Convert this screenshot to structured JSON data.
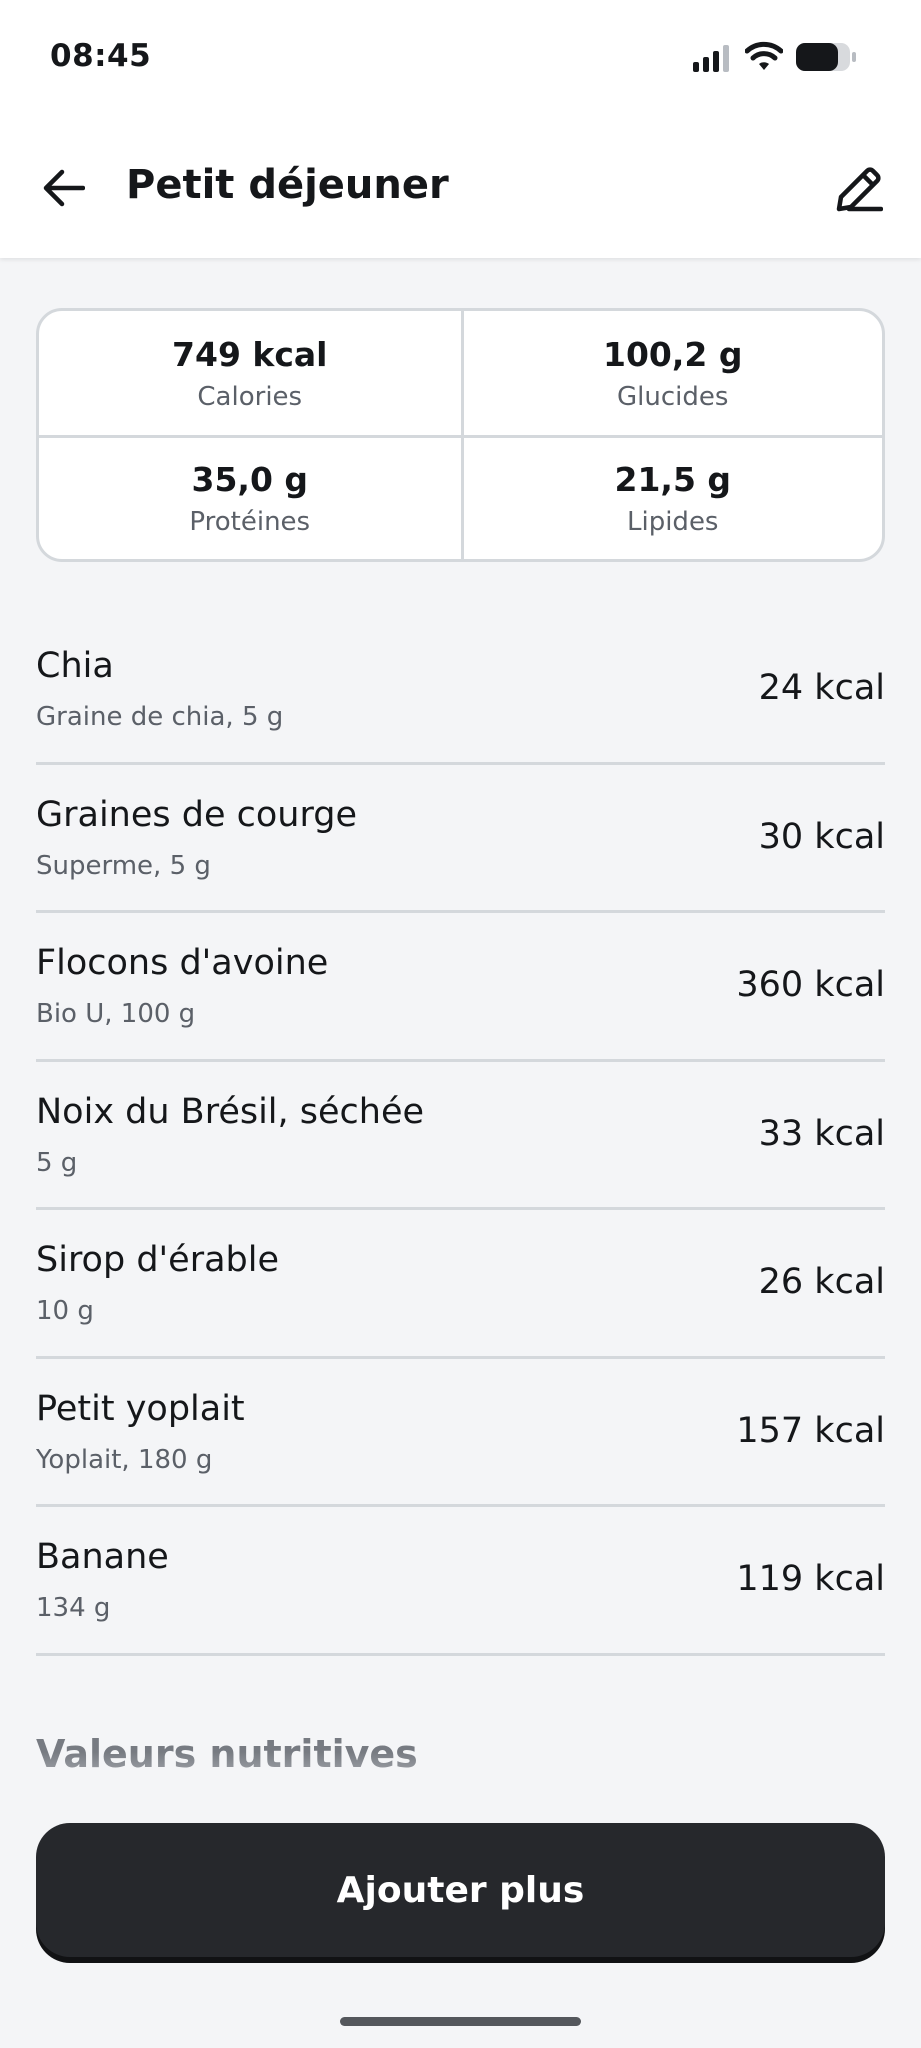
{
  "status_bar": {
    "time": "08:45"
  },
  "header": {
    "title": "Petit déjeuner"
  },
  "summary": [
    {
      "value": "749 kcal",
      "label": "Calories"
    },
    {
      "value": "100,2 g",
      "label": "Glucides"
    },
    {
      "value": "35,0 g",
      "label": "Protéines"
    },
    {
      "value": "21,5 g",
      "label": "Lipides"
    }
  ],
  "foods": [
    {
      "name": "Chia",
      "detail": "Graine de chia, 5 g",
      "kcal": "24 kcal"
    },
    {
      "name": "Graines de courge",
      "detail": "Superme, 5 g",
      "kcal": "30 kcal"
    },
    {
      "name": "Flocons d'avoine",
      "detail": "Bio U, 100 g",
      "kcal": "360 kcal"
    },
    {
      "name": "Noix du Brésil, séchée",
      "detail": "5 g",
      "kcal": "33 kcal"
    },
    {
      "name": "Sirop d'érable",
      "detail": "10 g",
      "kcal": "26 kcal"
    },
    {
      "name": "Petit yoplait",
      "detail": "Yoplait, 180 g",
      "kcal": "157 kcal"
    },
    {
      "name": "Banane",
      "detail": "134 g",
      "kcal": "119 kcal"
    }
  ],
  "section_title": "Valeurs nutritives",
  "add_button_label": "Ajouter plus",
  "icons": {
    "back": "arrow-left-icon",
    "edit": "pencil-icon",
    "signal": "cellular-signal-icon",
    "wifi": "wifi-icon",
    "battery": "battery-icon"
  }
}
